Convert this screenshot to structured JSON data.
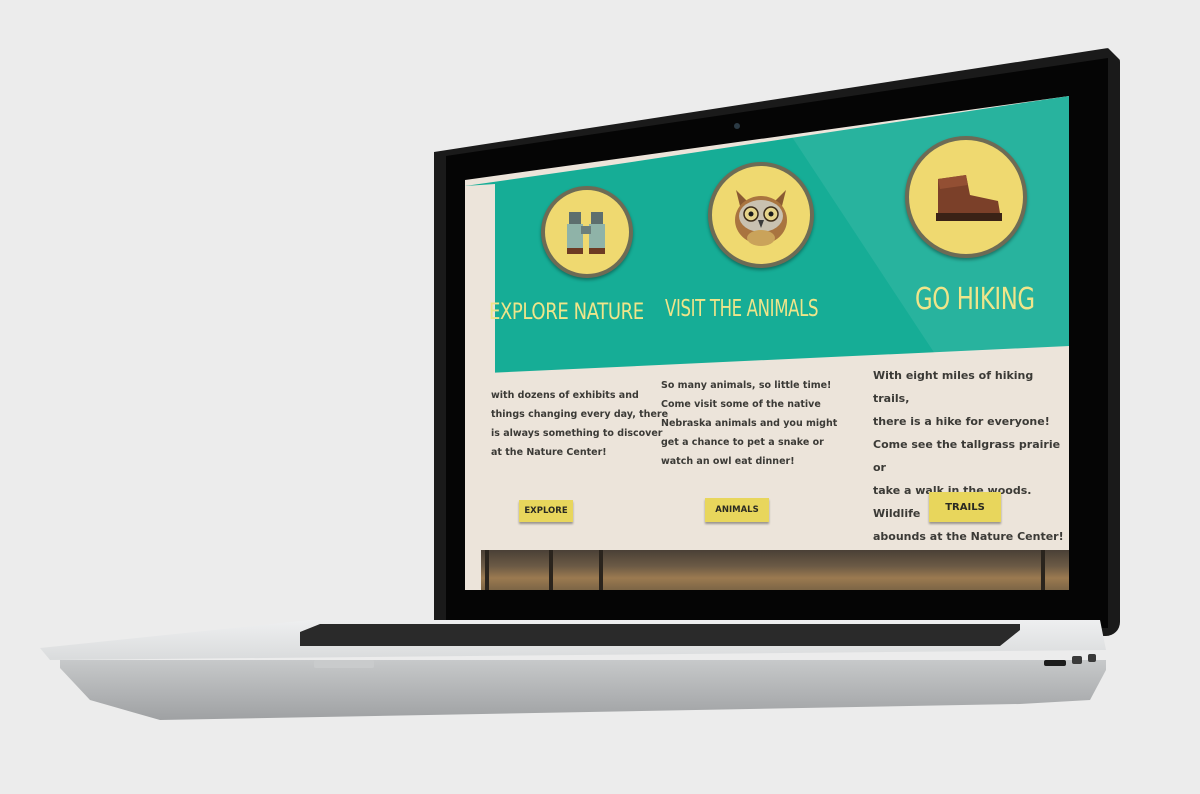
{
  "columns": [
    {
      "icon": "binoculars-icon",
      "heading": "EXPLORE NATURE",
      "text": [
        "with dozens of exhibits and",
        "things changing every day, there",
        "is always something to discover",
        "at the Nature Center!"
      ],
      "button": "EXPLORE"
    },
    {
      "icon": "owl-icon",
      "heading": "VISIT THE ANIMALS",
      "text": [
        "So many animals, so little time!",
        "Come visit some of the native",
        "Nebraska animals and you might",
        "get a chance to pet a snake or",
        "watch an owl eat dinner!"
      ],
      "button": "ANIMALS"
    },
    {
      "icon": "hiking-boot-icon",
      "heading": "GO HIKING",
      "text": [
        "With eight miles of hiking trails,",
        "there is a hike for everyone!",
        "Come see the tallgrass prairie or",
        "take a walk in the woods. Wildlife",
        "abounds at the Nature Center!"
      ],
      "button": "TRAILS"
    }
  ],
  "colors": {
    "teal": "#16ad96",
    "yellow": "#efd970",
    "beige": "#ece4da",
    "button": "#e8d65c"
  }
}
